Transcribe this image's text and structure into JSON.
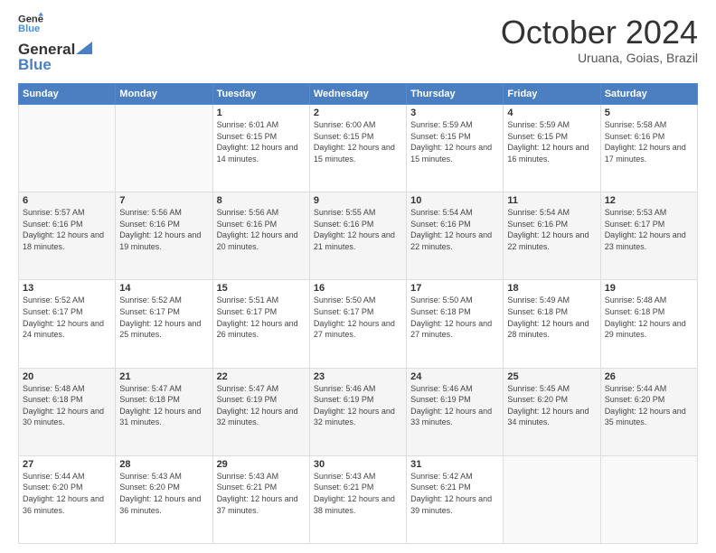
{
  "header": {
    "logo_line1": "General",
    "logo_line2": "Blue",
    "month": "October 2024",
    "location": "Uruana, Goias, Brazil"
  },
  "days_of_week": [
    "Sunday",
    "Monday",
    "Tuesday",
    "Wednesday",
    "Thursday",
    "Friday",
    "Saturday"
  ],
  "weeks": [
    [
      {
        "num": "",
        "info": ""
      },
      {
        "num": "",
        "info": ""
      },
      {
        "num": "1",
        "info": "Sunrise: 6:01 AM\nSunset: 6:15 PM\nDaylight: 12 hours and 14 minutes."
      },
      {
        "num": "2",
        "info": "Sunrise: 6:00 AM\nSunset: 6:15 PM\nDaylight: 12 hours and 15 minutes."
      },
      {
        "num": "3",
        "info": "Sunrise: 5:59 AM\nSunset: 6:15 PM\nDaylight: 12 hours and 15 minutes."
      },
      {
        "num": "4",
        "info": "Sunrise: 5:59 AM\nSunset: 6:15 PM\nDaylight: 12 hours and 16 minutes."
      },
      {
        "num": "5",
        "info": "Sunrise: 5:58 AM\nSunset: 6:16 PM\nDaylight: 12 hours and 17 minutes."
      }
    ],
    [
      {
        "num": "6",
        "info": "Sunrise: 5:57 AM\nSunset: 6:16 PM\nDaylight: 12 hours and 18 minutes."
      },
      {
        "num": "7",
        "info": "Sunrise: 5:56 AM\nSunset: 6:16 PM\nDaylight: 12 hours and 19 minutes."
      },
      {
        "num": "8",
        "info": "Sunrise: 5:56 AM\nSunset: 6:16 PM\nDaylight: 12 hours and 20 minutes."
      },
      {
        "num": "9",
        "info": "Sunrise: 5:55 AM\nSunset: 6:16 PM\nDaylight: 12 hours and 21 minutes."
      },
      {
        "num": "10",
        "info": "Sunrise: 5:54 AM\nSunset: 6:16 PM\nDaylight: 12 hours and 22 minutes."
      },
      {
        "num": "11",
        "info": "Sunrise: 5:54 AM\nSunset: 6:16 PM\nDaylight: 12 hours and 22 minutes."
      },
      {
        "num": "12",
        "info": "Sunrise: 5:53 AM\nSunset: 6:17 PM\nDaylight: 12 hours and 23 minutes."
      }
    ],
    [
      {
        "num": "13",
        "info": "Sunrise: 5:52 AM\nSunset: 6:17 PM\nDaylight: 12 hours and 24 minutes."
      },
      {
        "num": "14",
        "info": "Sunrise: 5:52 AM\nSunset: 6:17 PM\nDaylight: 12 hours and 25 minutes."
      },
      {
        "num": "15",
        "info": "Sunrise: 5:51 AM\nSunset: 6:17 PM\nDaylight: 12 hours and 26 minutes."
      },
      {
        "num": "16",
        "info": "Sunrise: 5:50 AM\nSunset: 6:17 PM\nDaylight: 12 hours and 27 minutes."
      },
      {
        "num": "17",
        "info": "Sunrise: 5:50 AM\nSunset: 6:18 PM\nDaylight: 12 hours and 27 minutes."
      },
      {
        "num": "18",
        "info": "Sunrise: 5:49 AM\nSunset: 6:18 PM\nDaylight: 12 hours and 28 minutes."
      },
      {
        "num": "19",
        "info": "Sunrise: 5:48 AM\nSunset: 6:18 PM\nDaylight: 12 hours and 29 minutes."
      }
    ],
    [
      {
        "num": "20",
        "info": "Sunrise: 5:48 AM\nSunset: 6:18 PM\nDaylight: 12 hours and 30 minutes."
      },
      {
        "num": "21",
        "info": "Sunrise: 5:47 AM\nSunset: 6:18 PM\nDaylight: 12 hours and 31 minutes."
      },
      {
        "num": "22",
        "info": "Sunrise: 5:47 AM\nSunset: 6:19 PM\nDaylight: 12 hours and 32 minutes."
      },
      {
        "num": "23",
        "info": "Sunrise: 5:46 AM\nSunset: 6:19 PM\nDaylight: 12 hours and 32 minutes."
      },
      {
        "num": "24",
        "info": "Sunrise: 5:46 AM\nSunset: 6:19 PM\nDaylight: 12 hours and 33 minutes."
      },
      {
        "num": "25",
        "info": "Sunrise: 5:45 AM\nSunset: 6:20 PM\nDaylight: 12 hours and 34 minutes."
      },
      {
        "num": "26",
        "info": "Sunrise: 5:44 AM\nSunset: 6:20 PM\nDaylight: 12 hours and 35 minutes."
      }
    ],
    [
      {
        "num": "27",
        "info": "Sunrise: 5:44 AM\nSunset: 6:20 PM\nDaylight: 12 hours and 36 minutes."
      },
      {
        "num": "28",
        "info": "Sunrise: 5:43 AM\nSunset: 6:20 PM\nDaylight: 12 hours and 36 minutes."
      },
      {
        "num": "29",
        "info": "Sunrise: 5:43 AM\nSunset: 6:21 PM\nDaylight: 12 hours and 37 minutes."
      },
      {
        "num": "30",
        "info": "Sunrise: 5:43 AM\nSunset: 6:21 PM\nDaylight: 12 hours and 38 minutes."
      },
      {
        "num": "31",
        "info": "Sunrise: 5:42 AM\nSunset: 6:21 PM\nDaylight: 12 hours and 39 minutes."
      },
      {
        "num": "",
        "info": ""
      },
      {
        "num": "",
        "info": ""
      }
    ]
  ]
}
